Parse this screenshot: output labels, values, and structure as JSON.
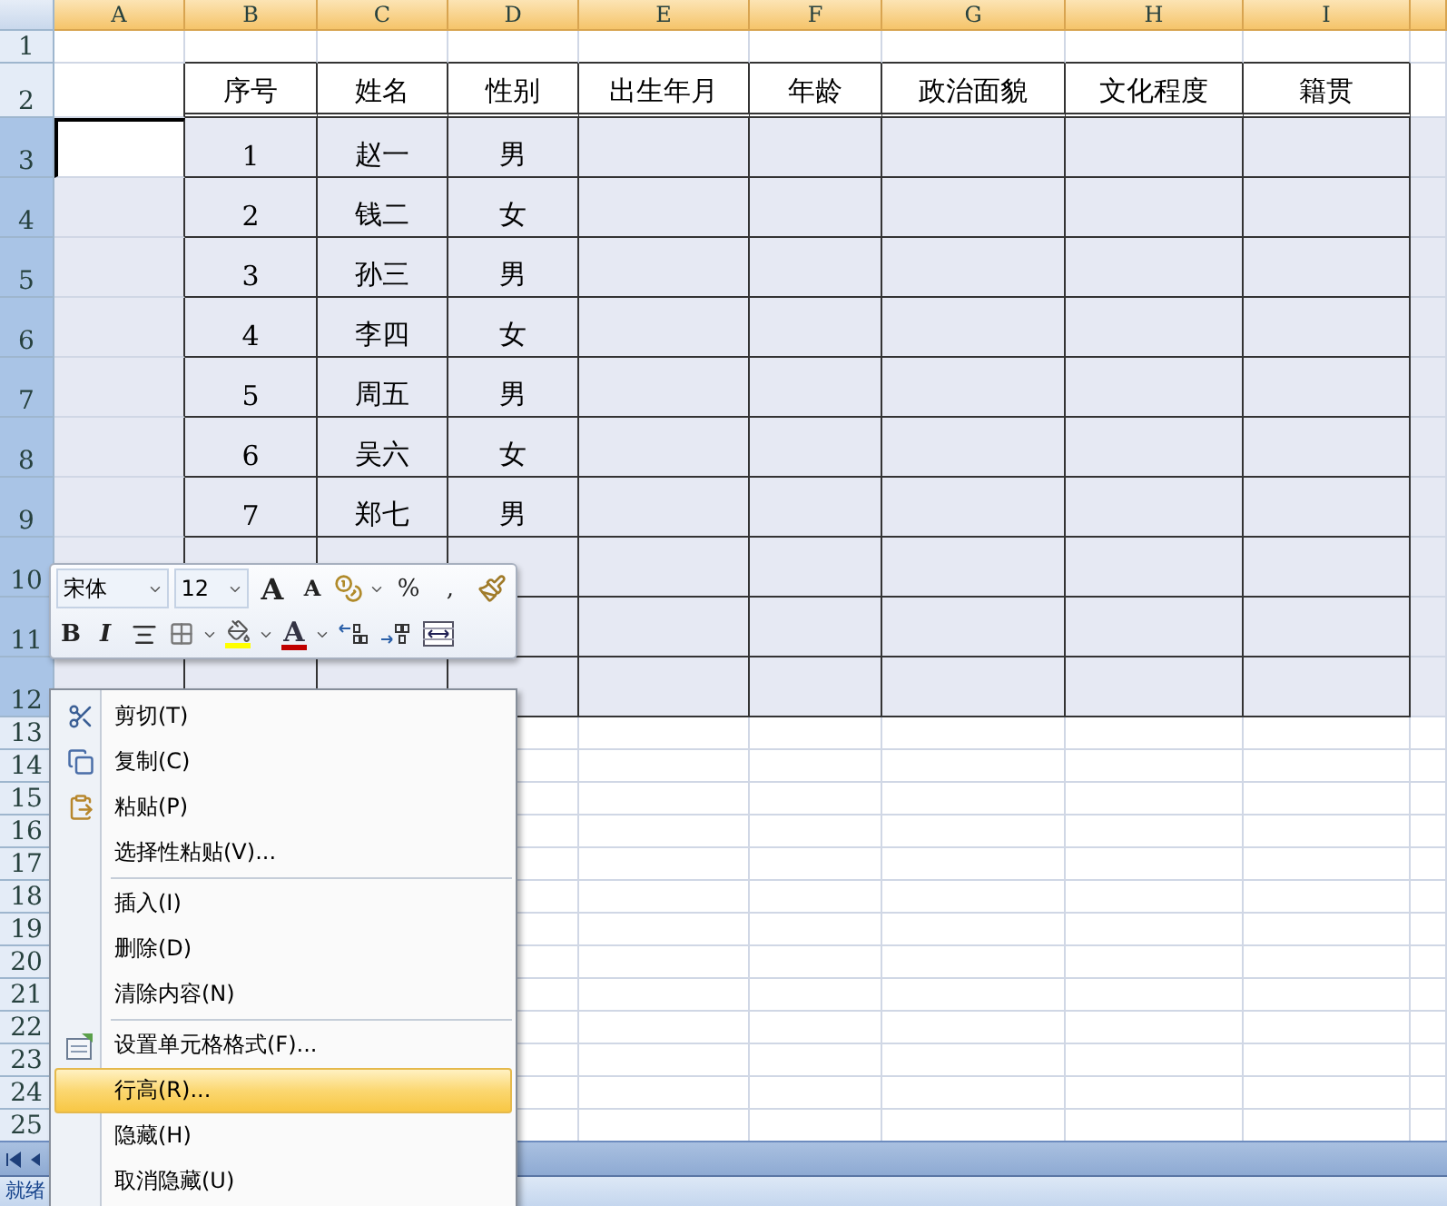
{
  "columns": [
    {
      "label": "A",
      "selected": true
    },
    {
      "label": "B",
      "selected": true
    },
    {
      "label": "C",
      "selected": true
    },
    {
      "label": "D",
      "selected": true
    },
    {
      "label": "E",
      "selected": true
    },
    {
      "label": "F",
      "selected": true
    },
    {
      "label": "G",
      "selected": true
    },
    {
      "label": "H",
      "selected": true
    },
    {
      "label": "I",
      "selected": true
    }
  ],
  "rows": [
    {
      "label": "1",
      "selected": false,
      "bordered": false
    },
    {
      "label": "2",
      "selected": false,
      "bordered": true,
      "cells": [
        "序号",
        "姓名",
        "性别",
        "出生年月",
        "年龄",
        "政治面貌",
        "文化程度",
        "籍贯"
      ]
    },
    {
      "label": "3",
      "selected": true,
      "bordered": true,
      "active": true,
      "cells": [
        "1",
        "赵一",
        "男"
      ]
    },
    {
      "label": "4",
      "selected": true,
      "bordered": true,
      "cells": [
        "2",
        "钱二",
        "女"
      ]
    },
    {
      "label": "5",
      "selected": true,
      "bordered": true,
      "cells": [
        "3",
        "孙三",
        "男"
      ]
    },
    {
      "label": "6",
      "selected": true,
      "bordered": true,
      "cells": [
        "4",
        "李四",
        "女"
      ]
    },
    {
      "label": "7",
      "selected": true,
      "bordered": true,
      "cells": [
        "5",
        "周五",
        "男"
      ]
    },
    {
      "label": "8",
      "selected": true,
      "bordered": true,
      "cells": [
        "6",
        "吴六",
        "女"
      ]
    },
    {
      "label": "9",
      "selected": true,
      "bordered": true,
      "cells": [
        "7",
        "郑七",
        "男"
      ]
    },
    {
      "label": "10",
      "selected": true,
      "bordered": true
    },
    {
      "label": "11",
      "selected": true,
      "bordered": true
    },
    {
      "label": "12",
      "selected": true,
      "bordered": true
    },
    {
      "label": "13",
      "selected": false,
      "bordered": false
    },
    {
      "label": "14",
      "selected": false,
      "bordered": false
    },
    {
      "label": "15",
      "selected": false,
      "bordered": false
    },
    {
      "label": "16",
      "selected": false,
      "bordered": false
    },
    {
      "label": "17",
      "selected": false,
      "bordered": false
    },
    {
      "label": "18",
      "selected": false,
      "bordered": false
    },
    {
      "label": "19",
      "selected": false,
      "bordered": false
    },
    {
      "label": "20",
      "selected": false,
      "bordered": false
    },
    {
      "label": "21",
      "selected": false,
      "bordered": false
    },
    {
      "label": "22",
      "selected": false,
      "bordered": false
    },
    {
      "label": "23",
      "selected": false,
      "bordered": false
    },
    {
      "label": "24",
      "selected": false,
      "bordered": false
    },
    {
      "label": "25",
      "selected": false,
      "bordered": false
    }
  ],
  "mini_toolbar": {
    "font": "宋体",
    "size": "12",
    "row_1": [
      {
        "kind": "grow",
        "label": "A"
      },
      {
        "kind": "shrink",
        "label": "A"
      },
      {
        "kind": "accounting"
      },
      {
        "kind": "dropdown"
      },
      {
        "kind": "text",
        "label": "%"
      },
      {
        "kind": "text",
        "label": ","
      },
      {
        "kind": "painter"
      }
    ],
    "row_2": [
      {
        "kind": "bold",
        "label": "B"
      },
      {
        "kind": "italic",
        "label": "I"
      },
      {
        "kind": "center"
      },
      {
        "kind": "borders"
      },
      {
        "kind": "dropdown"
      },
      {
        "kind": "fill",
        "color": "#ffff00"
      },
      {
        "kind": "dropdown"
      },
      {
        "kind": "fontcolor",
        "label": "A",
        "color": "#c00000"
      },
      {
        "kind": "dropdown"
      },
      {
        "kind": "incdec"
      },
      {
        "kind": "decdec"
      },
      {
        "kind": "merge"
      }
    ]
  },
  "context_menu": [
    {
      "kind": "item",
      "label": "剪切(T)",
      "selected": false
    },
    {
      "kind": "item",
      "label": "复制(C)",
      "selected": false
    },
    {
      "kind": "item",
      "label": "粘贴(P)",
      "selected": false
    },
    {
      "kind": "item",
      "label": "选择性粘贴(V)...",
      "selected": false
    },
    {
      "kind": "separator"
    },
    {
      "kind": "item",
      "label": "插入(I)",
      "selected": false
    },
    {
      "kind": "item",
      "label": "删除(D)",
      "selected": false
    },
    {
      "kind": "item",
      "label": "清除内容(N)",
      "selected": false
    },
    {
      "kind": "separator"
    },
    {
      "kind": "item",
      "label": "设置单元格格式(F)...",
      "selected": false
    },
    {
      "kind": "item",
      "label": "行高(R)...",
      "selected": true
    },
    {
      "kind": "item",
      "label": "隐藏(H)",
      "selected": false
    },
    {
      "kind": "item",
      "label": "取消隐藏(U)",
      "selected": false
    }
  ],
  "status_bar": {
    "text": "就绪"
  }
}
